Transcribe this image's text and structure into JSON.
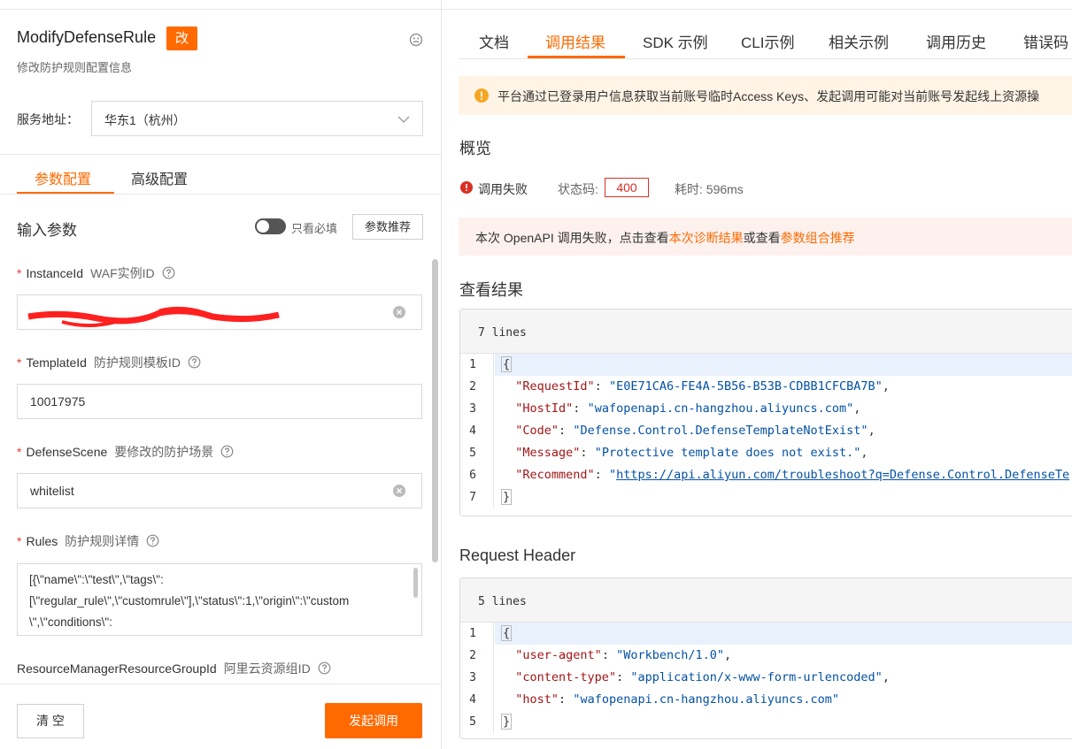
{
  "api": {
    "title": "ModifyDefenseRule",
    "badge": "改",
    "description": "修改防护规则配置信息"
  },
  "service": {
    "label": "服务地址：",
    "value": "华东1（杭州）"
  },
  "left_tabs": {
    "params": "参数配置",
    "advanced": "高级配置"
  },
  "input_section": {
    "title": "输入参数",
    "toggle_label": "只看必填",
    "recommend_button": "参数推荐"
  },
  "fields": {
    "instance": {
      "name": "InstanceId",
      "desc": "WAF实例ID",
      "required": "*"
    },
    "template": {
      "name": "TemplateId",
      "desc": "防护规则模板ID",
      "required": "*",
      "value": "10017975"
    },
    "scene": {
      "name": "DefenseScene",
      "desc": "要修改的防护场景",
      "required": "*",
      "value": "whitelist"
    },
    "rules": {
      "name": "Rules",
      "desc": "防护规则详情",
      "required": "*",
      "value_lines": [
        "[{\\\"name\\\":\\\"test\\\",\\\"tags\\\":",
        "[\\\"regular_rule\\\",\\\"customrule\\\"],\\\"status\\\":1,\\\"origin\\\":\\\"custom",
        "\\\",\\\"conditions\\\":"
      ]
    },
    "rg": {
      "name": "ResourceManagerResourceGroupId",
      "desc": "阿里云资源组ID"
    }
  },
  "footer": {
    "clear": "清 空",
    "invoke": "发起调用"
  },
  "right_tabs": [
    "文档",
    "调用结果",
    "SDK 示例",
    "CLI示例",
    "相关示例",
    "调用历史",
    "错误码"
  ],
  "notice": "平台通过已登录用户信息获取当前账号临时Access Keys、发起调用可能对当前账号发起线上资源操",
  "overview": {
    "title": "概览",
    "status": "调用失败",
    "code_label": "状态码:",
    "code": "400",
    "time": "耗时: 596ms"
  },
  "fail_msg": {
    "prefix": "本次 OpenAPI 调用失败，点击查看",
    "link1": "本次诊断结果",
    "middle": "或查看",
    "link2": "参数组合推荐"
  },
  "result": {
    "title": "查看结果",
    "lines": "7 lines",
    "request_id_key": "\"RequestId\"",
    "request_id": "\"E0E71CA6-FE4A-5B56-B53B-CDBB1CFCBA7B\"",
    "host_id_key": "\"HostId\"",
    "host_id": "\"wafopenapi.cn-hangzhou.aliyuncs.com\"",
    "code_key": "\"Code\"",
    "code": "\"Defense.Control.DefenseTemplateNotExist\"",
    "message_key": "\"Message\"",
    "message": "\"Protective template does not exist.\"",
    "recommend_key": "\"Recommend\"",
    "recommend": "https://api.aliyun.com/troubleshoot?q=Defense.Control.DefenseTe"
  },
  "request_header": {
    "title": "Request Header",
    "lines": "5 lines",
    "ua_key": "\"user-agent\"",
    "ua": "\"Workbench/1.0\"",
    "ct_key": "\"content-type\"",
    "ct": "\"application/x-www-form-urlencoded\"",
    "host_key": "\"host\"",
    "host": "\"wafopenapi.cn-hangzhou.aliyuncs.com\""
  },
  "colors": {
    "accent": "#ff6a00",
    "error": "#d93025"
  }
}
